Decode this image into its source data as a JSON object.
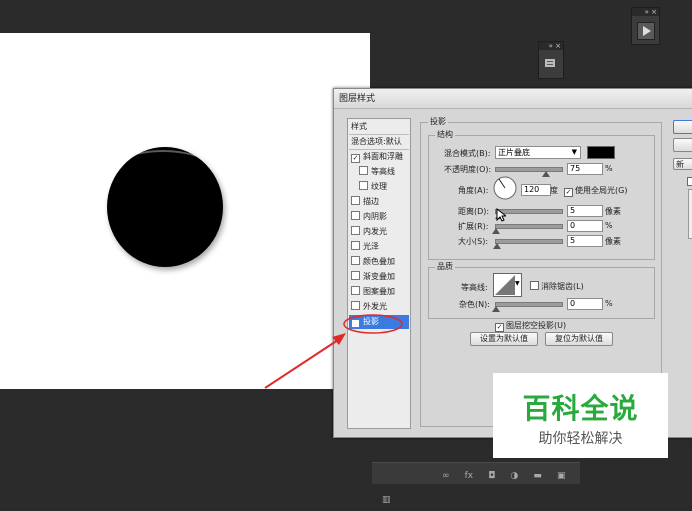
{
  "dialog": {
    "title": "图层样式",
    "style_list": {
      "header": "样式",
      "blend_defaults": "混合选项:默认",
      "items": [
        {
          "label": "斜面和浮雕",
          "checked": true,
          "indent": false
        },
        {
          "label": "等高线",
          "checked": false,
          "indent": true
        },
        {
          "label": "纹理",
          "checked": false,
          "indent": true
        },
        {
          "label": "描边",
          "checked": false,
          "indent": false
        },
        {
          "label": "内阴影",
          "checked": false,
          "indent": false
        },
        {
          "label": "内发光",
          "checked": false,
          "indent": false
        },
        {
          "label": "光泽",
          "checked": false,
          "indent": false
        },
        {
          "label": "颜色叠加",
          "checked": false,
          "indent": false
        },
        {
          "label": "渐变叠加",
          "checked": false,
          "indent": false
        },
        {
          "label": "图案叠加",
          "checked": false,
          "indent": false
        },
        {
          "label": "外发光",
          "checked": false,
          "indent": false
        },
        {
          "label": "投影",
          "checked": true,
          "indent": false,
          "selected": true
        }
      ]
    },
    "drop_shadow": {
      "section_title": "投影",
      "structure_title": "结构",
      "blend_mode_label": "混合模式(B):",
      "blend_mode_value": "正片叠底",
      "shadow_color": "#000000",
      "opacity_label": "不透明度(O):",
      "opacity_value": "75",
      "angle_label": "角度(A):",
      "angle_value": "120",
      "angle_unit": "度",
      "global_light_label": "使用全局光(G)",
      "global_light_checked": true,
      "distance_label": "距离(D):",
      "distance_value": "5",
      "spread_label": "扩展(R):",
      "spread_value": "0",
      "size_label": "大小(S):",
      "size_value": "5",
      "unit_px": "像素",
      "unit_pct": "%",
      "quality_title": "品质",
      "contour_label": "等高线:",
      "anti_alias_label": "消除锯齿(L)",
      "noise_label": "杂色(N):",
      "noise_value": "0",
      "knockout_label": "图层挖空投影(U)",
      "set_default_button": "设置为默认值",
      "reset_default_button": "复位为默认值"
    },
    "side_button_partial": "新"
  },
  "watermark": {
    "title": "百科全说",
    "subtitle": "助你轻松解决"
  },
  "bottom_bar": {
    "fx_label": "fx"
  },
  "colors": {
    "selection": "#3b7ae0",
    "annotation_red": "#e02a2a",
    "watermark_green": "#2aaa3e"
  }
}
